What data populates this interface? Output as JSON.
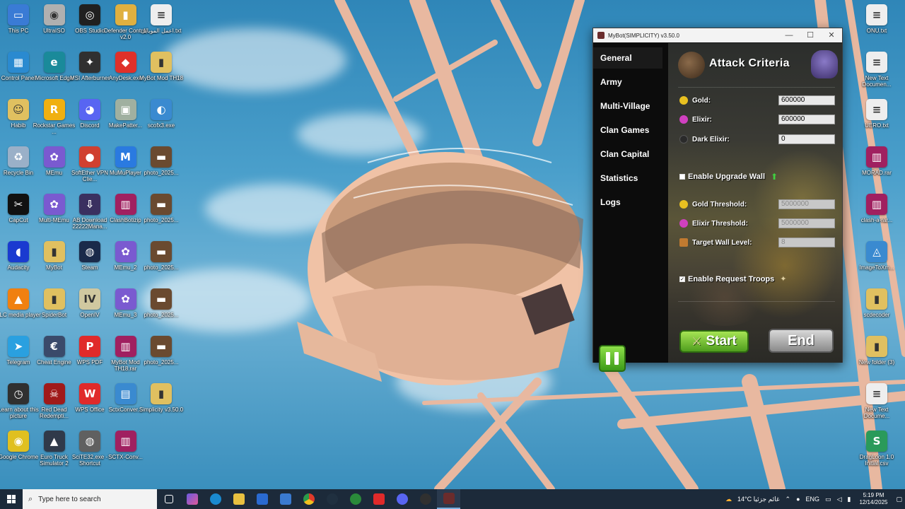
{
  "desktop": {
    "left_icons": [
      {
        "label": "This PC",
        "color": "#3a7bd5",
        "glyph": "▭"
      },
      {
        "label": "UltraISO",
        "color": "#b0b0b0",
        "glyph": "◉"
      },
      {
        "label": "OBS Studio",
        "color": "#202020",
        "glyph": "◎"
      },
      {
        "label": "Defender Control v2.0",
        "color": "#e0b040",
        "glyph": "▮"
      },
      {
        "label": "اعمل الموبايل.txt",
        "color": "#eeeeee",
        "glyph": "≡"
      },
      {
        "label": "Control Panel",
        "color": "#2a8ad0",
        "glyph": "▦"
      },
      {
        "label": "Microsoft Edge",
        "color": "#1a8a9a",
        "glyph": "e"
      },
      {
        "label": "MSI Afterburner",
        "color": "#303030",
        "glyph": "✦"
      },
      {
        "label": "AnyDesk.exe",
        "color": "#e0302a",
        "glyph": "◆"
      },
      {
        "label": "MyBot Mod TH18",
        "color": "#e0c060",
        "glyph": "▮"
      },
      {
        "label": "Habib",
        "color": "#e0c060",
        "glyph": "☺"
      },
      {
        "label": "Rockstar Games ...",
        "color": "#f0b010",
        "glyph": "R"
      },
      {
        "label": "Discord",
        "color": "#5865f2",
        "glyph": "◕"
      },
      {
        "label": "MakePatter...",
        "color": "#a0b0a0",
        "glyph": "▣"
      },
      {
        "label": "scofx3.exe",
        "color": "#3a8ad0",
        "glyph": "◐"
      },
      {
        "label": "Recycle Bin",
        "color": "#9ab0c8",
        "glyph": "♻"
      },
      {
        "label": "MEmu",
        "color": "#7a5ad0",
        "glyph": "✿"
      },
      {
        "label": "SoftEther VPN Clie...",
        "color": "#d04030",
        "glyph": "●"
      },
      {
        "label": "MuMuPlayer",
        "color": "#2a7ae0",
        "glyph": "M"
      },
      {
        "label": "photo_2025...",
        "color": "#6a4a30",
        "glyph": "▬"
      },
      {
        "label": "CapCut",
        "color": "#111111",
        "glyph": "✂"
      },
      {
        "label": "Multi-MEmu",
        "color": "#7a5ad0",
        "glyph": "✿"
      },
      {
        "label": "AB Download 22222Mana...",
        "color": "#3a3060",
        "glyph": "⇩"
      },
      {
        "label": "ClashBotizip",
        "color": "#a02060",
        "glyph": "▥"
      },
      {
        "label": "photo_2025...",
        "color": "#6a4a30",
        "glyph": "▬"
      },
      {
        "label": "Audacity",
        "color": "#1a3ad0",
        "glyph": "◖"
      },
      {
        "label": "MyBot",
        "color": "#e0c060",
        "glyph": "▮"
      },
      {
        "label": "Steam",
        "color": "#1a2a4a",
        "glyph": "◍"
      },
      {
        "label": "MEmu_2",
        "color": "#7a5ad0",
        "glyph": "✿"
      },
      {
        "label": "photo_2025...",
        "color": "#6a4a30",
        "glyph": "▬"
      },
      {
        "label": "VLC media player",
        "color": "#f08010",
        "glyph": "▲"
      },
      {
        "label": "SpiderBot",
        "color": "#e0c060",
        "glyph": "▮"
      },
      {
        "label": "OpenIV",
        "color": "#d0c8a0",
        "glyph": "IV"
      },
      {
        "label": "MEmu_3",
        "color": "#7a5ad0",
        "glyph": "✿"
      },
      {
        "label": "photo_2025...",
        "color": "#6a4a30",
        "glyph": "▬"
      },
      {
        "label": "Telegram",
        "color": "#2aa0e0",
        "glyph": "➤"
      },
      {
        "label": "Cheat Engine",
        "color": "#3a4a6a",
        "glyph": "€"
      },
      {
        "label": "WPS PDF",
        "color": "#e02a2a",
        "glyph": "P"
      },
      {
        "label": "MyBot Mod TH18.rar",
        "color": "#a02060",
        "glyph": "▥"
      },
      {
        "label": "photo_2025...",
        "color": "#6a4a30",
        "glyph": "▬"
      },
      {
        "label": "Learn about this picture",
        "color": "#303030",
        "glyph": "◷"
      },
      {
        "label": "Red Dead Redempti...",
        "color": "#a01a1a",
        "glyph": "☠"
      },
      {
        "label": "WPS Office",
        "color": "#e02a2a",
        "glyph": "W"
      },
      {
        "label": "SctxConver...",
        "color": "#3a8ad0",
        "glyph": "▤"
      },
      {
        "label": "Simplicity v3.50.0",
        "color": "#e0c060",
        "glyph": "▮"
      },
      {
        "label": "Google Chrome",
        "color": "#e0c020",
        "glyph": "◉"
      },
      {
        "label": "Euro Truck Simulator 2",
        "color": "#303a4a",
        "glyph": "▲"
      },
      {
        "label": "SciTE32.exe - Shortcut",
        "color": "#606060",
        "glyph": "◍"
      },
      {
        "label": "SCTX-Conv...",
        "color": "#a02060",
        "glyph": "▥"
      }
    ],
    "right_icons": [
      {
        "label": "ONU.txt",
        "color": "#eeeeee",
        "glyph": "≡"
      },
      {
        "label": "New Text Documen...",
        "color": "#eeeeee",
        "glyph": "≡"
      },
      {
        "label": "UERO.txt",
        "color": "#eeeeee",
        "glyph": "≡"
      },
      {
        "label": "MORAD.rar",
        "color": "#a02060",
        "glyph": "▥"
      },
      {
        "label": "clash-a-rar...",
        "color": "#a02060",
        "glyph": "▥"
      },
      {
        "label": "ImageToXm...",
        "color": "#3a8ad0",
        "glyph": "◬"
      },
      {
        "label": "scdecoder",
        "color": "#e0c060",
        "glyph": "▮"
      },
      {
        "label": "New folder (3)",
        "color": "#e0c060",
        "glyph": "▮"
      },
      {
        "label": "New Text Docume...",
        "color": "#eeeeee",
        "glyph": "≡"
      },
      {
        "label": "DragLoon 1.0 Initial.csv",
        "color": "#2a9a5a",
        "glyph": "S"
      }
    ]
  },
  "bot": {
    "title": "MyBot(SIMPLICITY)   v3.50.0",
    "controls": {
      "min": "—",
      "max": "☐",
      "close": "✕"
    },
    "menu": [
      "General",
      "Army",
      "Multi-Village",
      "Clan Games",
      "Clan Capital",
      "Statistics",
      "Logs"
    ],
    "header": "Attack Criteria",
    "resources": [
      {
        "label": "Gold:",
        "value": "600000",
        "color": "#e8c020"
      },
      {
        "label": "Elixir:",
        "value": "600000",
        "color": "#d040c0"
      },
      {
        "label": "Dark Elixir:",
        "value": "0",
        "color": "#2a2a2a"
      }
    ],
    "upgrade_wall": {
      "label": "Enable Upgrade Wall",
      "checked": false
    },
    "thresholds": [
      {
        "label": "Gold Threshold:",
        "value": "5000000",
        "color": "#e8c020"
      },
      {
        "label": "Elixir Threshold:",
        "value": "5000000",
        "color": "#d040c0"
      },
      {
        "label": "Target Wall Level:",
        "value": "8",
        "color": "#c07a30"
      }
    ],
    "request_troops": {
      "label": "Enable Request Troops",
      "checked": true
    },
    "buttons": {
      "start": "Start",
      "end": "End"
    }
  },
  "taskbar": {
    "search_placeholder": "Type here to search",
    "weather": "14°C  غائم جزئيا",
    "lang": "ENG",
    "time": "5:19 PM",
    "date": "12/14/2025"
  }
}
